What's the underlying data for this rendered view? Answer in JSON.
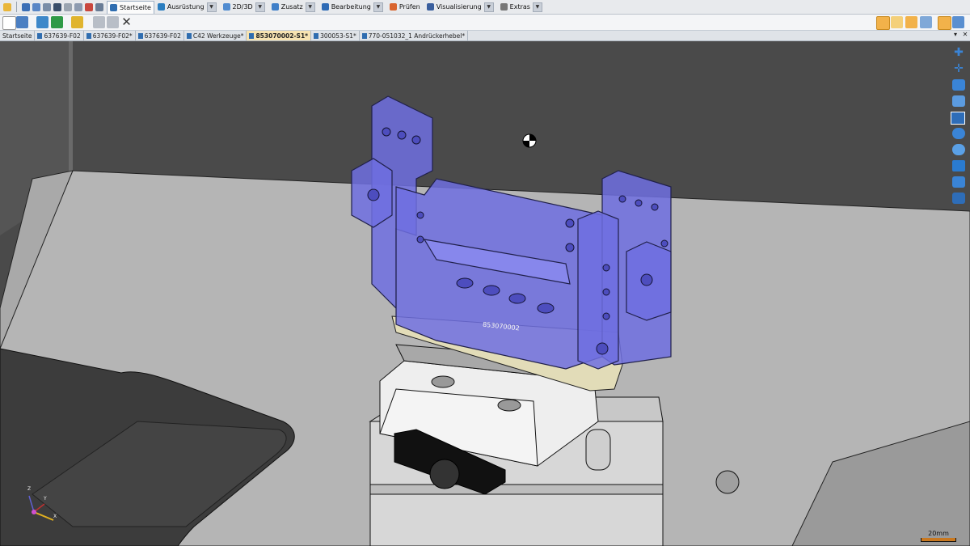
{
  "menu": {
    "tabs": [
      {
        "label": "Startseite",
        "active": true
      },
      {
        "label": "Ausrüstung"
      },
      {
        "label": "2D/3D"
      },
      {
        "label": "Zusatz"
      },
      {
        "label": "Bearbeitung"
      },
      {
        "label": "Prüfen"
      },
      {
        "label": "Visualisierung"
      },
      {
        "label": "Extras"
      }
    ]
  },
  "doc_tabs": [
    {
      "label": "Startseite"
    },
    {
      "label": "637639-F02"
    },
    {
      "label": "637639-F02*"
    },
    {
      "label": "637639-F02"
    },
    {
      "label": "C42 Werkzeuge*"
    },
    {
      "label": "853070002-S1*",
      "active": true
    },
    {
      "label": "300053-S1*"
    },
    {
      "label": "770-051032_1 Andrückerhebel*"
    }
  ],
  "viewport": {
    "part_label": "853070002",
    "scale_label": "20mm",
    "axes": {
      "z": "Z",
      "x": "X",
      "y": "Y"
    }
  },
  "colors": {
    "background": "#4a4a4a",
    "fixture": "#6f6fe0",
    "active_tab": "#f7e3b1",
    "accent": "#2f6db0"
  }
}
